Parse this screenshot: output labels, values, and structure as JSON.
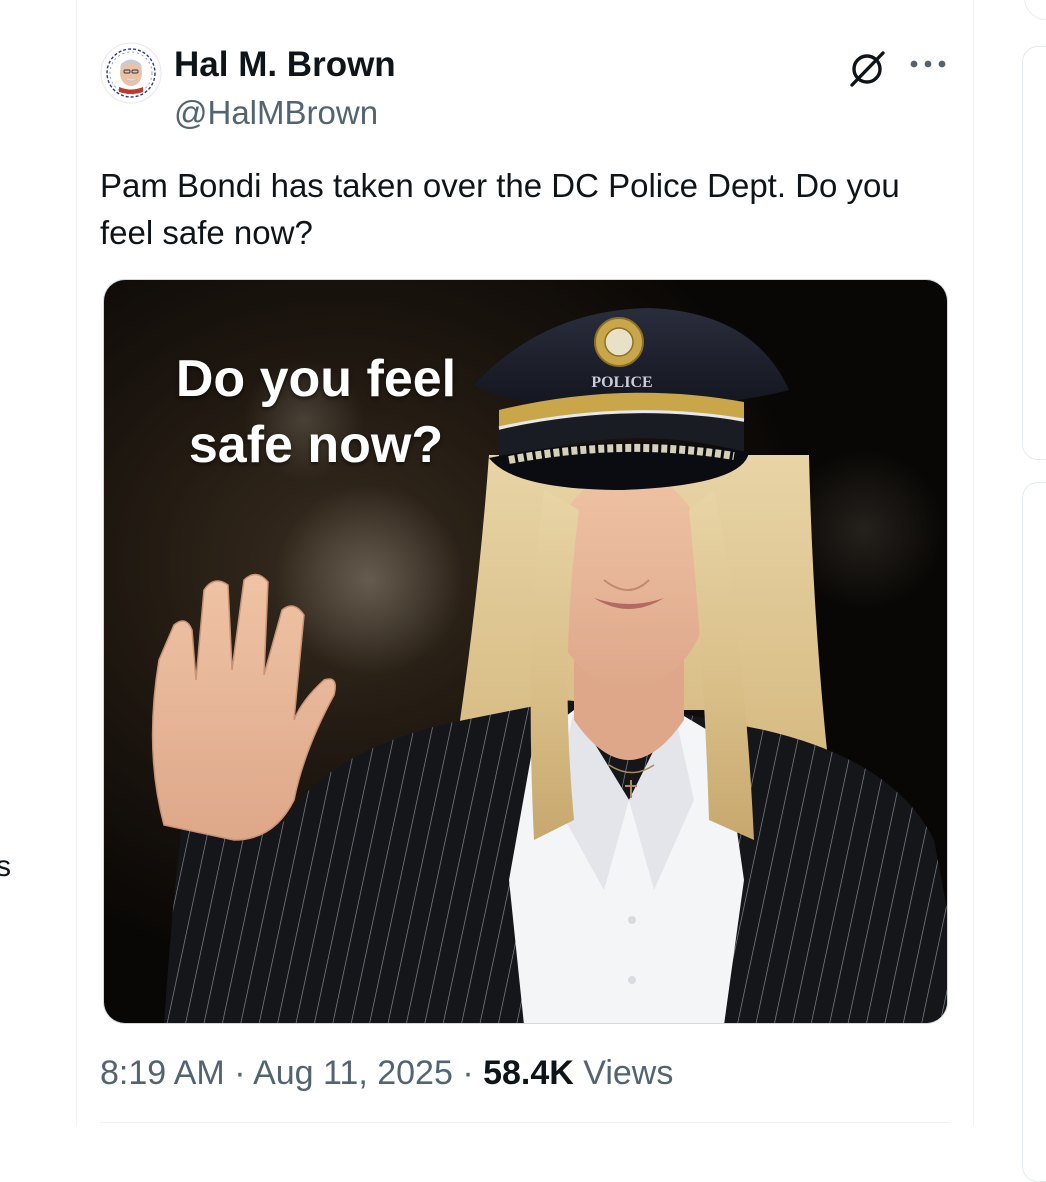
{
  "app": {
    "left_edge_fragment": "s"
  },
  "post": {
    "author": {
      "name": "Hal M. Brown",
      "handle": "@HalMBrown"
    },
    "actions": {
      "grok_icon": "slashed-circle-icon",
      "more_icon": "more-horizontal-icon"
    },
    "text": "Pam Bondi has taken over the DC Police Dept. Do you feel safe now?",
    "media": {
      "caption": "Do you feel safe now?",
      "cap_badge_text": "POLICE"
    },
    "meta": {
      "time": "8:19 AM",
      "separator": " · ",
      "date": "Aug 11, 2025",
      "views_count": "58.4K",
      "views_label": " Views"
    }
  },
  "colors": {
    "text_primary": "#0f1419",
    "text_secondary": "#536471",
    "border": "#eff3f4",
    "media_border": "#cfd9de"
  }
}
